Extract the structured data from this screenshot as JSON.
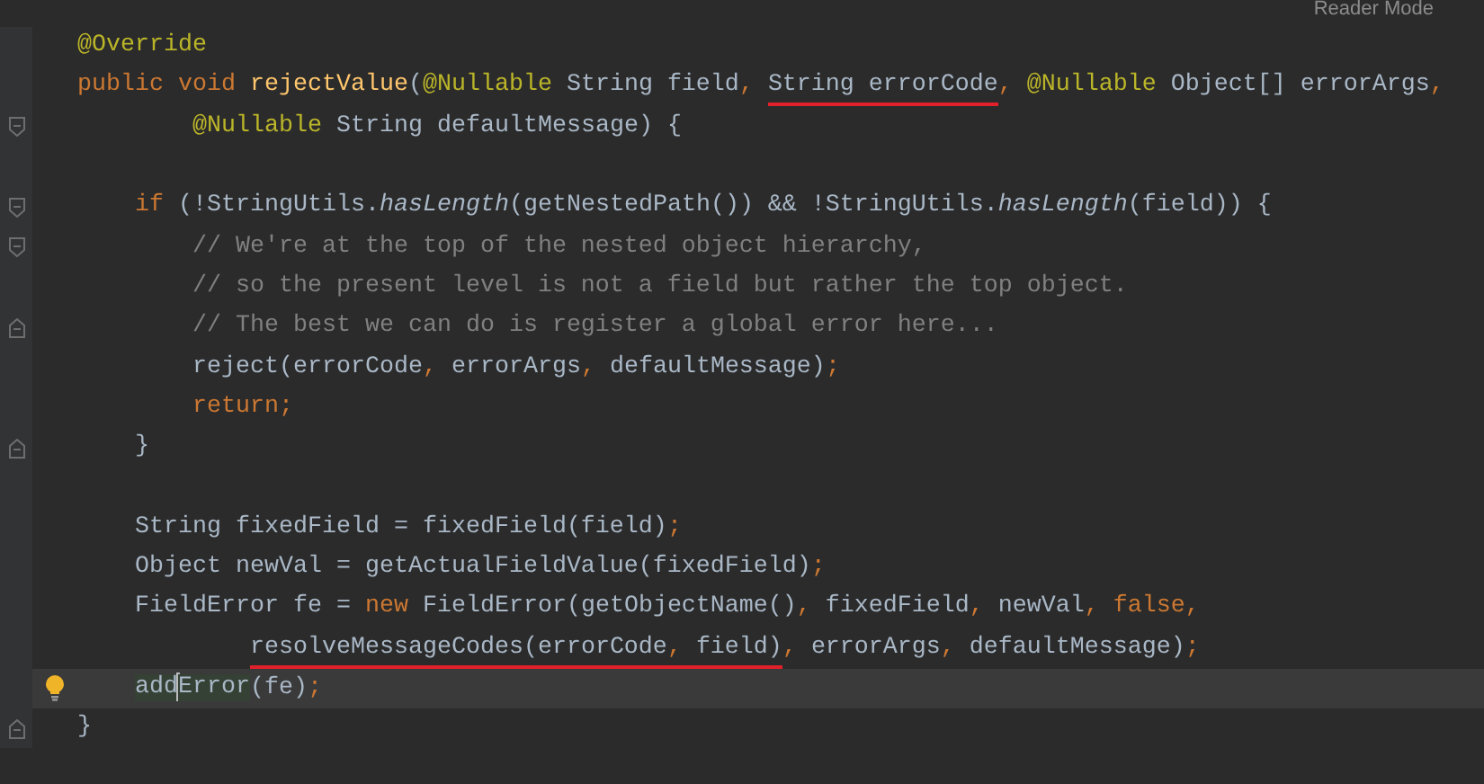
{
  "header": {
    "reader_mode": "Reader Mode"
  },
  "lines": [
    {
      "current": false,
      "bulb": false,
      "segments": [
        {
          "kind": "ann",
          "text": "@Override"
        }
      ]
    },
    {
      "current": false,
      "bulb": false,
      "segments": [
        {
          "kind": "kw",
          "text": "public void "
        },
        {
          "kind": "fn",
          "text": "rejectValue"
        },
        {
          "kind": "txt",
          "text": "("
        },
        {
          "kind": "ann",
          "text": "@Nullable"
        },
        {
          "kind": "txt",
          "text": " String field"
        },
        {
          "kind": "pu",
          "text": ", "
        },
        {
          "kind": "marked",
          "segments": [
            {
              "kind": "txt",
              "text": "String errorCode"
            }
          ]
        },
        {
          "kind": "pu",
          "text": ", "
        },
        {
          "kind": "ann",
          "text": "@Nullable"
        },
        {
          "kind": "txt",
          "text": " Object[] errorArgs"
        },
        {
          "kind": "pu",
          "text": ","
        }
      ]
    },
    {
      "current": false,
      "bulb": false,
      "fold": {
        "kind": "start"
      },
      "segments": [
        {
          "kind": "ann",
          "text": "        @Nullable"
        },
        {
          "kind": "txt",
          "text": " String defaultMessage) {"
        }
      ]
    },
    {
      "current": false,
      "bulb": false
    },
    {
      "current": false,
      "bulb": false,
      "fold": {
        "kind": "start"
      },
      "segments": [
        {
          "kind": "kw",
          "text": "    if "
        },
        {
          "kind": "txt",
          "text": "(!StringUtils."
        },
        {
          "kind": "it",
          "text": "hasLength"
        },
        {
          "kind": "txt",
          "text": "(getNestedPath()) && !StringUtils."
        },
        {
          "kind": "it",
          "text": "hasLength"
        },
        {
          "kind": "txt",
          "text": "(field)) {"
        }
      ]
    },
    {
      "current": false,
      "bulb": false,
      "fold": {
        "kind": "start"
      },
      "segments": [
        {
          "kind": "cm",
          "text": "        // We're at the top of the nested object hierarchy,"
        }
      ]
    },
    {
      "current": false,
      "bulb": false,
      "segments": [
        {
          "kind": "cm",
          "text": "        // so the present level is not a field but rather the top object."
        }
      ]
    },
    {
      "current": false,
      "bulb": false,
      "fold": {
        "kind": "end"
      },
      "segments": [
        {
          "kind": "cm",
          "text": "        // The best we can do is register a global error here..."
        }
      ]
    },
    {
      "current": false,
      "bulb": false,
      "segments": [
        {
          "kind": "txt",
          "text": "        reject(errorCode"
        },
        {
          "kind": "pu",
          "text": ", "
        },
        {
          "kind": "txt",
          "text": "errorArgs"
        },
        {
          "kind": "pu",
          "text": ", "
        },
        {
          "kind": "txt",
          "text": "defaultMessage)"
        },
        {
          "kind": "pu",
          "text": ";"
        }
      ]
    },
    {
      "current": false,
      "bulb": false,
      "segments": [
        {
          "kind": "kw",
          "text": "        return;"
        }
      ]
    },
    {
      "current": false,
      "bulb": false,
      "fold": {
        "kind": "end"
      },
      "segments": [
        {
          "kind": "txt",
          "text": "    }"
        }
      ]
    },
    {
      "current": false,
      "bulb": false
    },
    {
      "current": false,
      "bulb": false,
      "segments": [
        {
          "kind": "txt",
          "text": "    String fixedField = fixedField(field)"
        },
        {
          "kind": "pu",
          "text": ";"
        }
      ]
    },
    {
      "current": false,
      "bulb": false,
      "segments": [
        {
          "kind": "txt",
          "text": "    Object newVal = getActualFieldValue(fixedField)"
        },
        {
          "kind": "pu",
          "text": ";"
        }
      ]
    },
    {
      "current": false,
      "bulb": false,
      "segments": [
        {
          "kind": "txt",
          "text": "    FieldError fe = "
        },
        {
          "kind": "kw",
          "text": "new "
        },
        {
          "kind": "txt",
          "text": "FieldError(getObjectName()"
        },
        {
          "kind": "pu",
          "text": ", "
        },
        {
          "kind": "txt",
          "text": "fixedField"
        },
        {
          "kind": "pu",
          "text": ", "
        },
        {
          "kind": "txt",
          "text": "newVal"
        },
        {
          "kind": "pu",
          "text": ", "
        },
        {
          "kind": "kw",
          "text": "false"
        },
        {
          "kind": "pu",
          "text": ","
        }
      ]
    },
    {
      "current": false,
      "bulb": false,
      "segments": [
        {
          "kind": "marked",
          "segments": [
            {
              "kind": "txt",
              "text": "            resolveMessageCodes(errorCode"
            },
            {
              "kind": "pu",
              "text": ", "
            },
            {
              "kind": "txt",
              "text": "field)"
            }
          ]
        },
        {
          "kind": "pu",
          "text": ", "
        },
        {
          "kind": "txt",
          "text": "errorArgs"
        },
        {
          "kind": "pu",
          "text": ", "
        },
        {
          "kind": "txt",
          "text": "defaultMessage)"
        },
        {
          "kind": "pu",
          "text": ";"
        }
      ]
    },
    {
      "current": true,
      "bulb": true,
      "segments": [
        {
          "kind": "usage",
          "text": "    add"
        },
        {
          "kind": "caret"
        },
        {
          "kind": "usage",
          "text": "Error"
        },
        {
          "kind": "txt",
          "text": "(fe)"
        },
        {
          "kind": "pu",
          "text": ";"
        }
      ]
    },
    {
      "current": false,
      "bulb": false,
      "fold": {
        "kind": "end"
      },
      "segments": [
        {
          "kind": "txt",
          "text": "}"
        }
      ]
    }
  ]
}
